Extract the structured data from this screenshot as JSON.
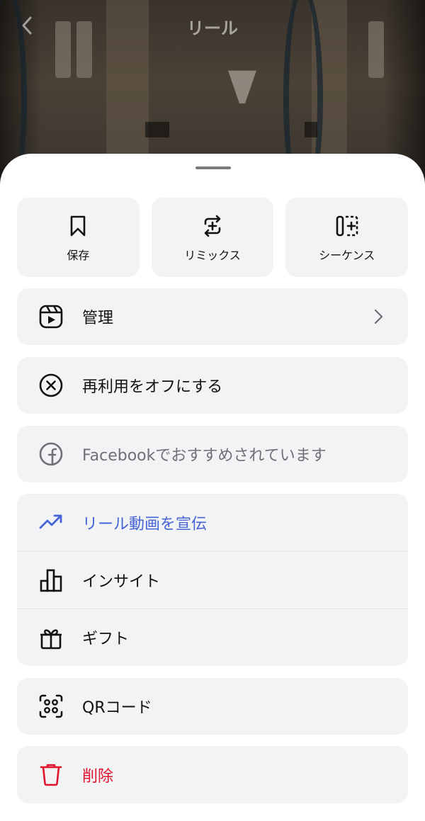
{
  "header": {
    "title": "リール"
  },
  "quick_actions": [
    {
      "label": "保存",
      "icon": "bookmark-icon"
    },
    {
      "label": "リミックス",
      "icon": "remix-icon"
    },
    {
      "label": "シーケンス",
      "icon": "sequence-icon"
    }
  ],
  "menu": {
    "manage": {
      "label": "管理",
      "icon": "reels-icon"
    },
    "reuse_off": {
      "label": "再利用をオフにする",
      "icon": "close-circle-icon"
    },
    "facebook": {
      "label": "Facebookでおすすめされています",
      "icon": "facebook-icon"
    },
    "promote": {
      "label": "リール動画を宣伝",
      "icon": "trending-up-icon"
    },
    "insights": {
      "label": "インサイト",
      "icon": "bar-chart-icon"
    },
    "gifts": {
      "label": "ギフト",
      "icon": "gift-icon"
    },
    "qr": {
      "label": "QRコード",
      "icon": "qr-code-icon"
    },
    "delete": {
      "label": "削除",
      "icon": "trash-icon"
    }
  },
  "colors": {
    "promote_blue": "#4764d6",
    "delete_red": "#e0142c",
    "muted_text": "#6e7075",
    "card_bg": "#f2f3f5"
  }
}
